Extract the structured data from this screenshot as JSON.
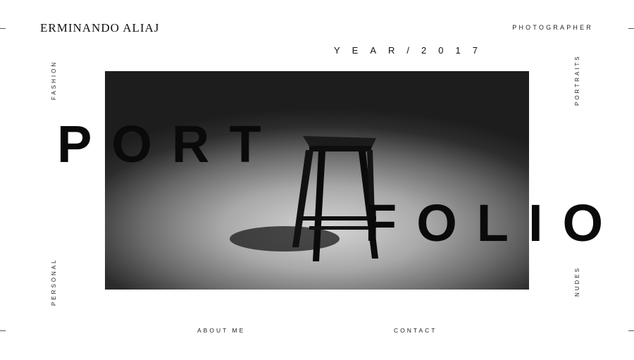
{
  "brand": {
    "name": "ERMINANDO ALIAJ"
  },
  "header": {
    "role": "PHOTOGRAPHER",
    "year": "YEAR/2017"
  },
  "nav": {
    "left_top": "FASHION",
    "left_bottom": "PERSONAL",
    "right_top": "PORTRAITS",
    "right_bottom": "NUDES"
  },
  "hero": {
    "word_top": "PORT",
    "word_bottom": "FOLIO"
  },
  "footer": {
    "about": "ABOUT ME",
    "contact": "CONTACT"
  },
  "colors": {
    "background": "#ffffff",
    "text": "#0a0a0a"
  }
}
